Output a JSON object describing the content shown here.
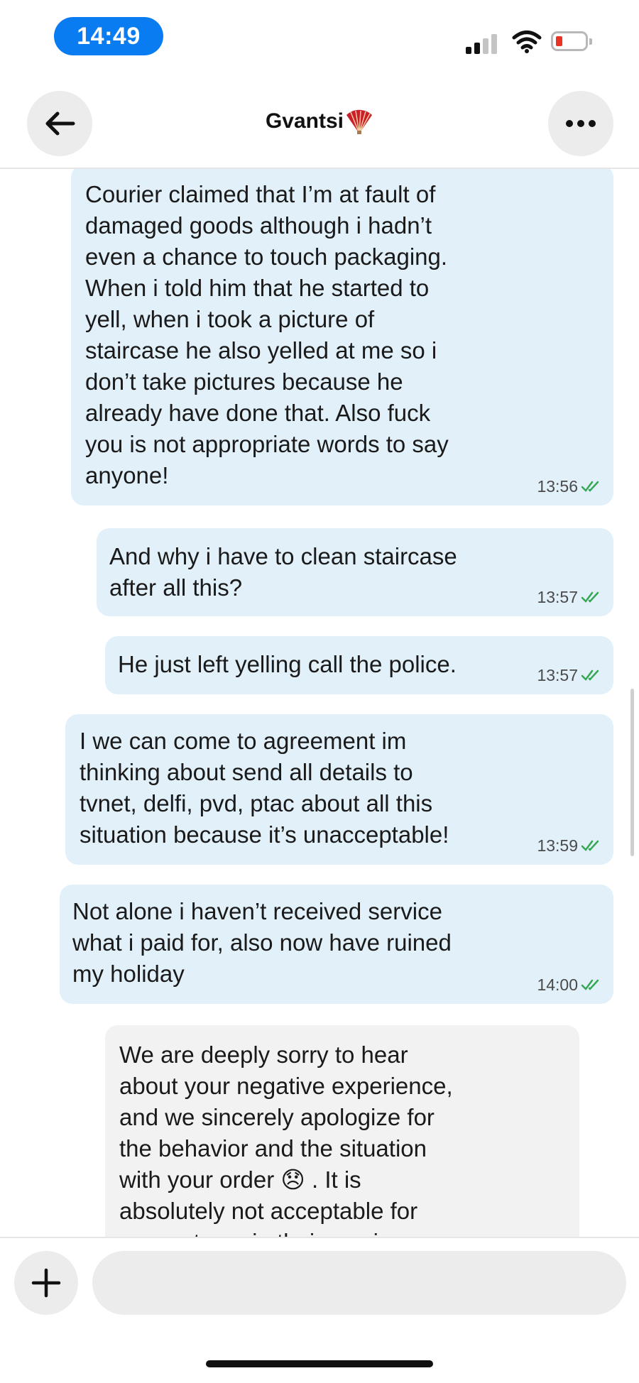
{
  "status": {
    "time": "14:49"
  },
  "header": {
    "title": "Gvantsi",
    "back_icon": "arrow-left-icon",
    "more_icon": "more-dots-icon",
    "title_emoji": "folding-fan-icon"
  },
  "colors": {
    "accent": "#0a7cf2",
    "outgoing_bubble": "#e2f0fa",
    "incoming_bubble": "#f2f2f2",
    "read_check": "#34a853"
  },
  "messages": [
    {
      "text": "Courier claimed that I’m at fault of\ndamaged goods although i hadn’t\neven a chance to touch packaging.\nWhen i told him that he started to\nyell, when i took a picture of\nstaircase he also yelled at me so i\ndon’t take pictures because he\nalready have done that. Also fuck\nyou is not appropriate words to say\nanyone!",
      "time": "13:56",
      "direction": "out"
    },
    {
      "text": "And why i have to clean staircase\nafter all this?",
      "time": "13:57",
      "direction": "out"
    },
    {
      "text": "He just left yelling call the police.",
      "time": "13:57",
      "direction": "out"
    },
    {
      "text": "I we can come to agreement im\nthinking about send all details to\ntvnet, delfi, pvd, ptac about all this\nsituation because it’s unacceptable!",
      "time": "13:59",
      "direction": "out"
    },
    {
      "text": "Not alone i haven’t received service\nwhat i paid for, also now have ruined\nmy holiday",
      "time": "14:00",
      "direction": "out"
    },
    {
      "text": "We are deeply sorry to hear\nabout your negative experience,\nand we sincerely apologize for\nthe behavior and the situation\nwith your order 😞 . It is\nabsolutely not acceptable for\nour partners in their service",
      "direction": "in"
    }
  ],
  "composer": {
    "placeholder": "",
    "add_icon": "plus-icon"
  }
}
